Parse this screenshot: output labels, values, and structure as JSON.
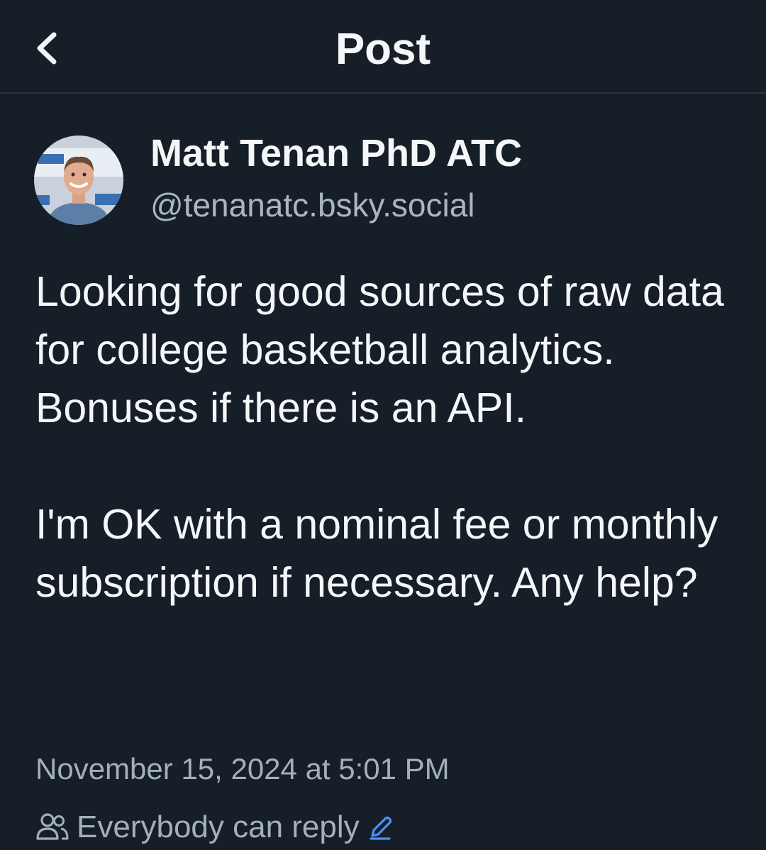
{
  "header": {
    "title": "Post",
    "back_icon": "chevron-left-icon"
  },
  "author": {
    "display_name": "Matt Tenan PhD ATC",
    "handle": "@tenanatc.bsky.social",
    "avatar_icon": "user-avatar"
  },
  "post": {
    "paragraphs": [
      "Looking for good sources of raw data for college basketball analytics. Bonuses if there is an API.",
      "I'm OK with a nominal fee or monthly subscription if necessary. Any help?"
    ],
    "timestamp": "November 15, 2024 at 5:01 PM",
    "reply_setting": "Everybody can reply",
    "reply_setting_icon": "people-icon",
    "edit_icon": "pencil-icon"
  },
  "colors": {
    "background": "#161e27",
    "text_primary": "#f4f6f8",
    "text_secondary": "#a3afbe",
    "accent": "#4f8ff7"
  }
}
